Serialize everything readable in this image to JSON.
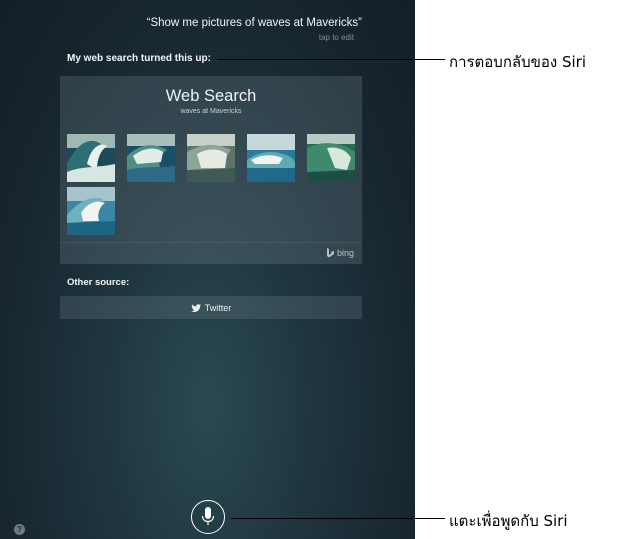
{
  "siri": {
    "query": "“Show me pictures of waves at Mavericks”",
    "tap_to_edit": "tap to edit",
    "intro": "My web search turned this up:",
    "web_search": {
      "title": "Web Search",
      "subtitle": "waves at Mavericks",
      "images": [
        {
          "alt": "wave image 1"
        },
        {
          "alt": "wave image 2"
        },
        {
          "alt": "wave image 3"
        },
        {
          "alt": "wave image 4"
        },
        {
          "alt": "wave image 5"
        },
        {
          "alt": "wave image 6"
        }
      ],
      "provider": "bing"
    },
    "other_source_label": "Other source:",
    "twitter_label": "Twitter",
    "help_label": "?"
  },
  "callouts": {
    "response": "การตอบกลับของ Siri",
    "tap_to_speak": "แตะเพื่อพูดกับ Siri"
  }
}
